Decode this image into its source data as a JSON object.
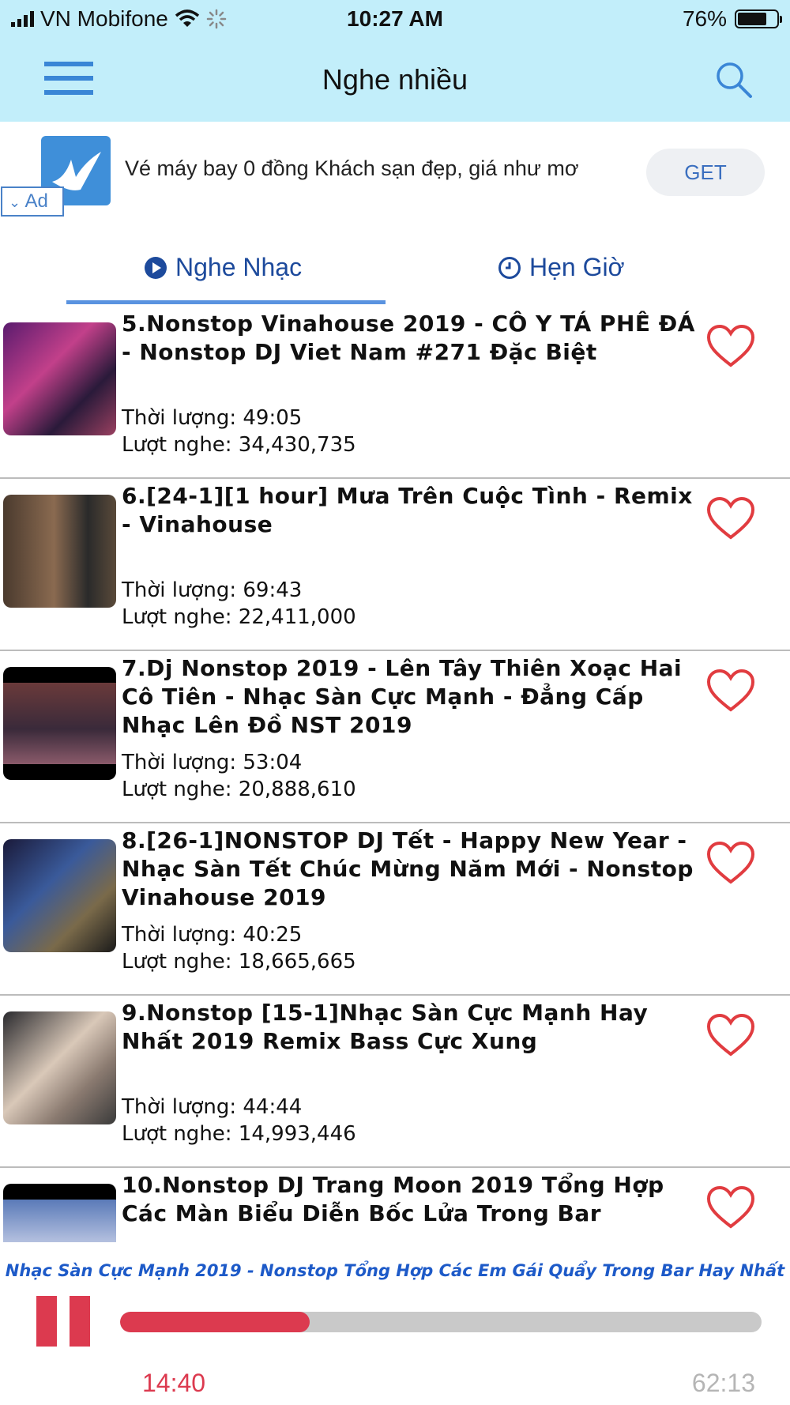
{
  "status_bar": {
    "carrier": "VN Mobifone",
    "time": "10:27 AM",
    "battery_text": "76%",
    "battery_level": 0.76
  },
  "nav": {
    "title": "Nghe nhiều"
  },
  "ad": {
    "text": "Vé máy bay 0 đồng Khách sạn đẹp, giá như mơ",
    "get_label": "GET",
    "badge_label": "Ad"
  },
  "tabs": [
    {
      "label": "Nghe Nhạc",
      "icon": "play-circle-icon",
      "active": true
    },
    {
      "label": "Hẹn Giờ",
      "icon": "clock-icon",
      "active": false
    }
  ],
  "tracks": [
    {
      "title": "5.Nonstop Vinahouse 2019 - CÔ Y TÁ PHÊ ĐÁ - Nonstop DJ Viet Nam #271 Đặc Biệt",
      "duration": "Thời lượng: 49:05",
      "views": "Lượt nghe: 34,430,735"
    },
    {
      "title": "6.[24-1][1 hour] Mưa Trên Cuộc Tình - Remix - Vinahouse",
      "duration": "Thời lượng: 69:43",
      "views": "Lượt nghe: 22,411,000"
    },
    {
      "title": "7.Dj Nonstop 2019 - Lên Tây Thiên Xoạc Hai Cô Tiên - Nhạc Sàn Cực Mạnh - Đẳng Cấp Nhạc Lên Đồ NST 2019",
      "duration": "Thời lượng: 53:04",
      "views": "Lượt nghe: 20,888,610"
    },
    {
      "title": "8.[26-1]NONSTOP DJ Tết - Happy New Year - Nhạc Sàn Tết Chúc Mừng Năm Mới - Nonstop Vinahouse 2019",
      "duration": "Thời lượng: 40:25",
      "views": "Lượt nghe: 18,665,665"
    },
    {
      "title": "9.Nonstop [15-1]Nhạc Sàn Cực Mạnh Hay Nhất 2019 Remix Bass Cực Xung",
      "duration": "Thời lượng: 44:44",
      "views": "Lượt nghe: 14,993,446"
    },
    {
      "title": "10.Nonstop DJ Trang Moon 2019 Tổng Hợp Các Màn Biểu Diễn Bốc Lửa Trong Bar",
      "duration": "",
      "views": ""
    }
  ],
  "player": {
    "now_playing": "Nhạc Sàn Cực Mạnh 2019 - Nonstop Tổng Hợp Các Em Gái Quẩy Trong Bar Hay Nhất",
    "current_time": "14:40",
    "total_time": "62:13",
    "progress": 0.296
  },
  "colors": {
    "header_bg": "#c2eefa",
    "accent_red": "#dc3a4f",
    "tab_blue": "#1d4a9c"
  }
}
